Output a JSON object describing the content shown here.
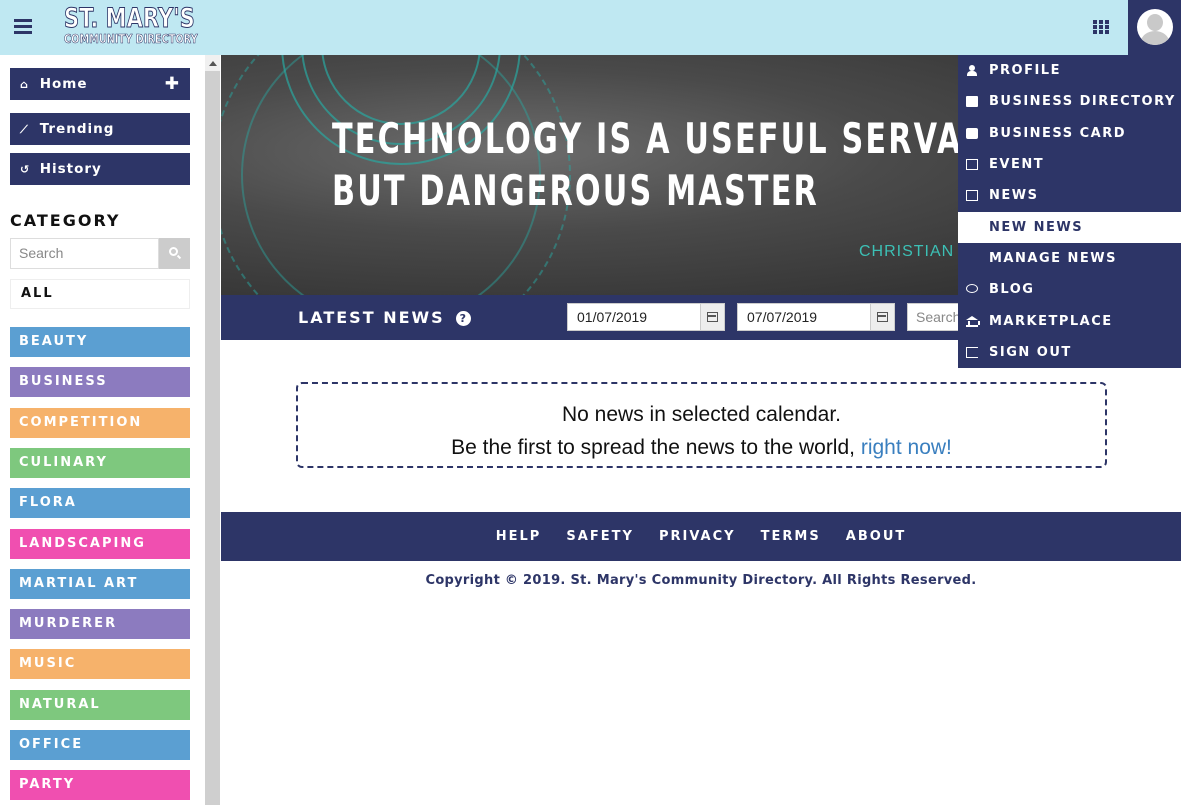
{
  "header": {
    "logo_line1": "ST. MARY'S",
    "logo_line2": "COMMUNITY DIRECTORY",
    "icons": [
      "menu-icon",
      "grid-icon",
      "avatar-icon"
    ]
  },
  "sidebar": {
    "nav": [
      {
        "label": "Home",
        "icon": "home-icon",
        "action": "plus-icon"
      },
      {
        "label": "Trending",
        "icon": "chart-line-icon"
      },
      {
        "label": "History",
        "icon": "history-icon"
      }
    ],
    "category_title": "CATEGORY",
    "search_placeholder": "Search",
    "all_label": "ALL",
    "categories": [
      {
        "label": "BEAUTY",
        "color": "#5b9fd2"
      },
      {
        "label": "BUSINESS",
        "color": "#8c7bbf"
      },
      {
        "label": "COMPETITION",
        "color": "#f6b26b"
      },
      {
        "label": "CULINARY",
        "color": "#7ec87e"
      },
      {
        "label": "FLORA",
        "color": "#5b9fd2"
      },
      {
        "label": "LANDSCAPING",
        "color": "#f04fb0"
      },
      {
        "label": "MARTIAL ART",
        "color": "#5b9fd2"
      },
      {
        "label": "MURDERER",
        "color": "#8c7bbf"
      },
      {
        "label": "MUSIC",
        "color": "#f6b26b"
      },
      {
        "label": "NATURAL DISASTER",
        "color": "#7ec87e"
      },
      {
        "label": "OFFICE",
        "color": "#5b9fd2"
      },
      {
        "label": "PARTY",
        "color": "#f04fb0"
      }
    ]
  },
  "hero": {
    "quote_line1": "TECHNOLOGY IS A USEFUL SERVANT",
    "quote_line2": "BUT DANGEROUS MASTER",
    "author": "CHRISTIAN"
  },
  "news_bar": {
    "title": "LATEST NEWS",
    "help_icon": "?",
    "date_from": "01/07/2019",
    "date_to": "07/07/2019",
    "search_placeholder": "Search"
  },
  "empty_state": {
    "line1": "No news in selected calendar.",
    "line2": "Be the first to spread the news to the world,",
    "link": "right now!"
  },
  "footer": {
    "links": [
      "HELP",
      "SAFETY",
      "PRIVACY",
      "TERMS",
      "ABOUT"
    ],
    "copyright": "Copyright © 2019. St. Mary's Community Directory. All Rights Reserved."
  },
  "dropdown": {
    "items": [
      {
        "label": "PROFILE",
        "icon": "user-icon"
      },
      {
        "label": "BUSINESS DIRECTORY",
        "icon": "folder-icon"
      },
      {
        "label": "BUSINESS CARD",
        "icon": "briefcase-icon"
      },
      {
        "label": "EVENT",
        "icon": "calendar-icon"
      },
      {
        "label": "NEWS",
        "icon": "newspaper-icon"
      },
      {
        "label": "NEW NEWS",
        "icon": "",
        "active": true
      },
      {
        "label": "MANAGE NEWS",
        "icon": ""
      },
      {
        "label": "BLOG",
        "icon": "comments-icon"
      },
      {
        "label": "MARKETPLACE",
        "icon": "bank-icon"
      },
      {
        "label": "SIGN OUT",
        "icon": "sign-out-icon"
      }
    ]
  },
  "colors": {
    "primary": "#2d3567",
    "topbar": "#bfe8f2",
    "accent_teal": "#3cc0b5",
    "link": "#3a7fbf"
  }
}
